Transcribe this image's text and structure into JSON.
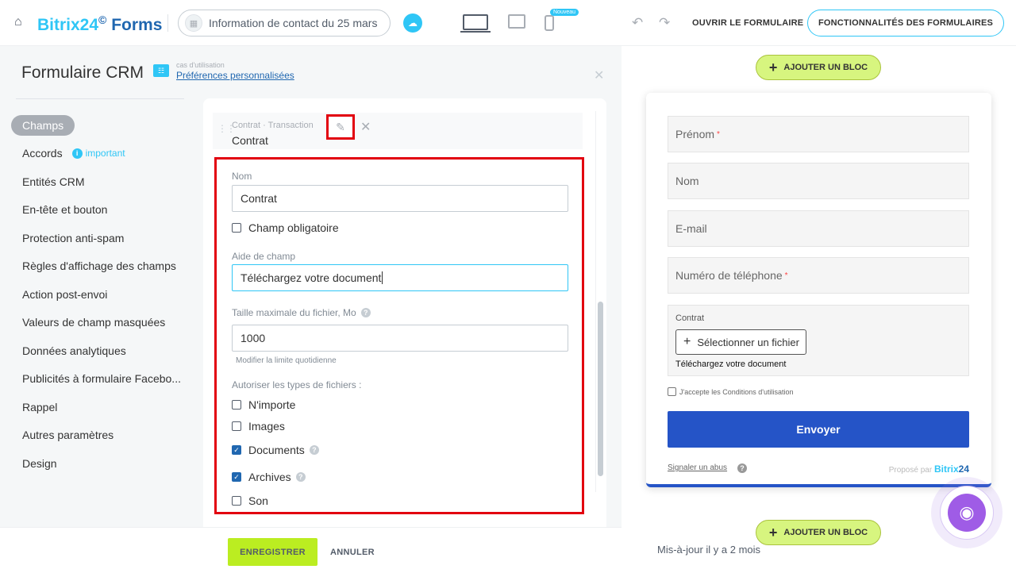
{
  "header": {
    "brand_name": "Bitrix24",
    "brand_clock": "©",
    "brand_suffix": "Forms",
    "form_name": "Information de contact du 25 mars",
    "new_badge": "Nouveau",
    "open_form_label": "OUVRIR LE FORMULAIRE",
    "features_label": "FONCTIONNALITÉS DES FORMULAIRES"
  },
  "panel": {
    "title": "Formulaire CRM",
    "usecase_label": "cas d'utilisation",
    "usecase_link": "Préférences personnalisées"
  },
  "sidebar": {
    "items": [
      {
        "label": "Champs"
      },
      {
        "label": "Accords",
        "note": "important"
      },
      {
        "label": "Entités CRM"
      },
      {
        "label": "En-tête et bouton"
      },
      {
        "label": "Protection anti-spam"
      },
      {
        "label": "Règles d'affichage des champs"
      },
      {
        "label": "Action post-envoi"
      },
      {
        "label": "Valeurs de champ masquées"
      },
      {
        "label": "Données analytiques"
      },
      {
        "label": "Publicités à formulaire Facebo..."
      },
      {
        "label": "Rappel"
      },
      {
        "label": "Autres paramètres"
      },
      {
        "label": "Design"
      }
    ]
  },
  "field_editor": {
    "field_type": "Contrat · Transaction",
    "field_title": "Contrat",
    "name_label": "Nom",
    "name_value": "Contrat",
    "required_label": "Champ obligatoire",
    "required_checked": false,
    "help_label": "Aide de champ",
    "help_value": "Téléchargez votre document",
    "max_size_label": "Taille maximale du fichier, Mo",
    "max_size_value": "1000",
    "daily_limit_hint": "Modifier la limite quotidienne",
    "file_types_label": "Autoriser les types de fichiers :",
    "file_types": [
      {
        "label": "N'importe",
        "checked": false,
        "help": false
      },
      {
        "label": "Images",
        "checked": false,
        "help": false
      },
      {
        "label": "Documents",
        "checked": true,
        "help": true
      },
      {
        "label": "Archives",
        "checked": true,
        "help": true
      },
      {
        "label": "Son",
        "checked": false,
        "help": false
      }
    ]
  },
  "footer": {
    "save_label": "ENREGISTRER",
    "cancel_label": "ANNULER"
  },
  "preview": {
    "add_block_label": "AJOUTER UN BLOC",
    "fields": [
      {
        "label": "Prénom",
        "required": true
      },
      {
        "label": "Nom",
        "required": false
      },
      {
        "label": "E-mail",
        "required": false
      },
      {
        "label": "Numéro de téléphone",
        "required": true
      }
    ],
    "required_mark": "*",
    "file_field_label": "Contrat",
    "file_button_label": "Sélectionner un fichier",
    "file_hint": "Téléchargez votre document",
    "terms_label": "J'accepte les Conditions d'utilisation",
    "send_label": "Envoyer",
    "report_label": "Signaler un abus",
    "powered_by_label": "Proposé par",
    "powered_by_brand": "Bitrix",
    "powered_by_number": "24",
    "updated_label": "Mis-à-jour il y a 2 mois"
  },
  "colors": {
    "accent": "#2fc6f6",
    "brand_dark": "#2067b0",
    "highlight_red": "#e2000f",
    "save_green": "#bbed21",
    "send_blue": "#2554c7"
  }
}
